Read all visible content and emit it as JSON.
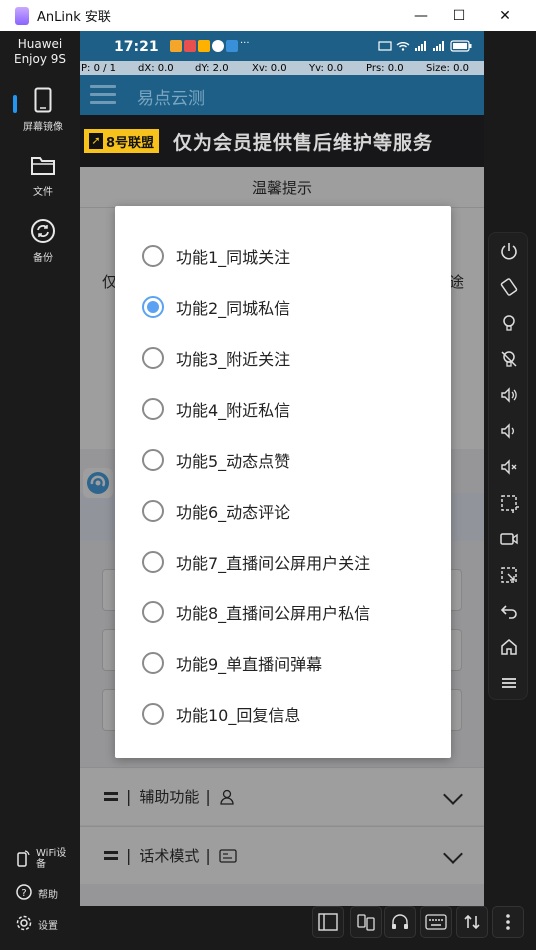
{
  "window": {
    "title": "AnLink 安联",
    "minimize_glyph": "—",
    "maximize_glyph": "☐",
    "close_glyph": "✕"
  },
  "sidebar": {
    "device_line1": "Huawei",
    "device_line2": "Enjoy 9S",
    "items": [
      {
        "label": "屏幕镜像",
        "icon": "phone-icon",
        "active": true
      },
      {
        "label": "文件",
        "icon": "folder-icon",
        "active": false
      },
      {
        "label": "备份",
        "icon": "sync-icon",
        "active": false
      }
    ],
    "bottom": [
      {
        "label": "WiFi设备",
        "icon": "phone-wifi-icon"
      },
      {
        "label": "帮助",
        "icon": "help-icon"
      },
      {
        "label": "设置",
        "icon": "gear-icon"
      }
    ]
  },
  "phone": {
    "status": {
      "time": "17:21",
      "more": "···"
    },
    "debug": {
      "p": "P: 0 / 1",
      "dx": "dX: 0.0",
      "dy": "dY: 2.0",
      "xv": "Xv: 0.0",
      "yv": "Yv: 0.0",
      "prs": "Prs: 0.0",
      "size": "Size: 0.0"
    },
    "app_title": "易点云测",
    "banner_badge": "8号联盟",
    "banner_text": "仅为会员提供售后维护等服务",
    "card_title": "温馨提示",
    "card_left": "仅",
    "card_right": "途",
    "sections": [
      {
        "label": "辅助功能"
      },
      {
        "label": "话术模式"
      }
    ],
    "dialog": {
      "options": [
        {
          "label": "功能1_同城关注",
          "checked": false
        },
        {
          "label": "功能2_同城私信",
          "checked": true
        },
        {
          "label": "功能3_附近关注",
          "checked": false
        },
        {
          "label": "功能4_附近私信",
          "checked": false
        },
        {
          "label": "功能5_动态点赞",
          "checked": false
        },
        {
          "label": "功能6_动态评论",
          "checked": false
        },
        {
          "label": "功能7_直播间公屏用户关注",
          "checked": false
        },
        {
          "label": "功能8_直播间公屏用户私信",
          "checked": false
        },
        {
          "label": "功能9_单直播间弹幕",
          "checked": false
        },
        {
          "label": "功能10_回复信息",
          "checked": false
        }
      ]
    }
  },
  "colors": {
    "accent": "#5ba3f2",
    "status_bar": "#1d5f86",
    "sidebar_active": "#2196f3"
  }
}
